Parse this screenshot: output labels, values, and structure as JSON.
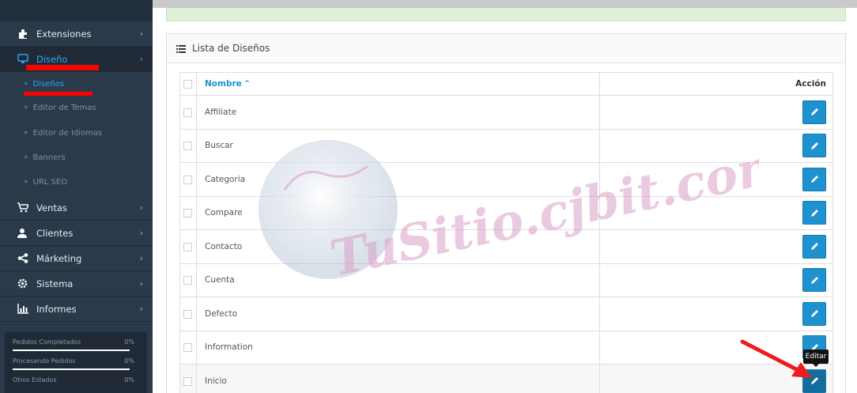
{
  "sidebar": {
    "items": [
      {
        "label": "Extensiones",
        "icon": "puzzle-icon"
      },
      {
        "label": "Diseño",
        "icon": "monitor-icon"
      },
      {
        "label": "Ventas",
        "icon": "cart-icon"
      },
      {
        "label": "Clientes",
        "icon": "user-icon"
      },
      {
        "label": "Márketing",
        "icon": "share-icon"
      },
      {
        "label": "Sistema",
        "icon": "gear-icon"
      },
      {
        "label": "Informes",
        "icon": "bar-chart-icon"
      }
    ],
    "submenu": [
      {
        "label": "Diseños"
      },
      {
        "label": "Editor de Temas"
      },
      {
        "label": "Editor de Idiomas"
      },
      {
        "label": "Banners"
      },
      {
        "label": "URL SEO"
      }
    ],
    "chevron": "›",
    "sub_arrow": "»",
    "stats": [
      {
        "label": "Pedidos Completados",
        "pct": "0%"
      },
      {
        "label": "Procesando Pedidos",
        "pct": "0%"
      },
      {
        "label": "Otros Estados",
        "pct": "0%"
      }
    ]
  },
  "panel": {
    "title": "Lista de Diseños"
  },
  "table": {
    "col_name": "Nombre",
    "sort_indicator": "^",
    "col_action": "Acción",
    "rows": [
      "Affiliate",
      "Buscar",
      "Categoria",
      "Compare",
      "Contacto",
      "Cuenta",
      "Defecto",
      "Information",
      "Inicio"
    ]
  },
  "tooltip": {
    "text": "Editar"
  },
  "watermark": {
    "text": "TuSitio.cjbit.com.ar"
  },
  "colors": {
    "accent": "#1e91cf",
    "sidebar_bg": "#2a3a4a",
    "highlight_red": "#ff0000",
    "alert_bg": "#dff0d8"
  }
}
